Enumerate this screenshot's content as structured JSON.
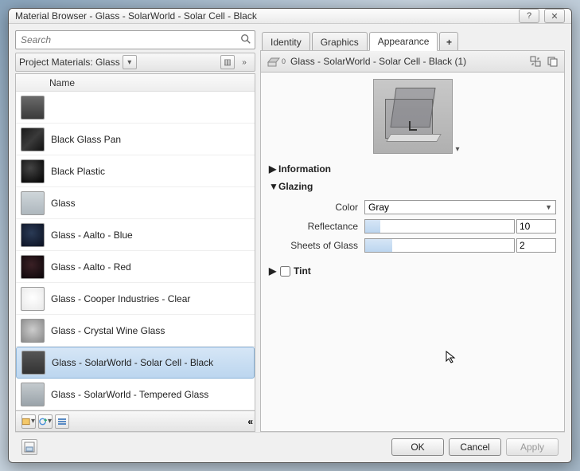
{
  "titlebar": {
    "title": "Material Browser - Glass - SolarWorld - Solar Cell - Black"
  },
  "search": {
    "placeholder": "Search"
  },
  "filter": {
    "label": "Project Materials: Glass"
  },
  "list": {
    "header": "Name",
    "items": [
      {
        "name": "",
        "sw": "sw-top"
      },
      {
        "name": "Black Glass Pan",
        "sw": "sw-blackglass"
      },
      {
        "name": "Black Plastic",
        "sw": "sw-blackplastic"
      },
      {
        "name": "Glass",
        "sw": "sw-glass"
      },
      {
        "name": "Glass - Aalto - Blue",
        "sw": "sw-aaltoblue"
      },
      {
        "name": "Glass - Aalto - Red",
        "sw": "sw-aaltored"
      },
      {
        "name": "Glass - Cooper Industries - Clear",
        "sw": "sw-cooper"
      },
      {
        "name": "Glass - Crystal Wine Glass",
        "sw": "sw-crystal"
      },
      {
        "name": "Glass - SolarWorld - Solar Cell - Black",
        "sw": "sw-solar",
        "selected": true
      },
      {
        "name": "Glass - SolarWorld - Tempered Glass",
        "sw": "sw-tempered"
      }
    ]
  },
  "tabs": {
    "identity": "Identity",
    "graphics": "Graphics",
    "appearance": "Appearance",
    "add": "+"
  },
  "asset": {
    "name": "Glass - SolarWorld - Solar Cell - Black (1)",
    "badge": "0"
  },
  "sections": {
    "information": "Information",
    "glazing": "Glazing",
    "tint": "Tint"
  },
  "props": {
    "color_label": "Color",
    "color_value": "Gray",
    "reflectance_label": "Reflectance",
    "reflectance_value": "10",
    "sheets_label": "Sheets of Glass",
    "sheets_value": "2"
  },
  "buttons": {
    "ok": "OK",
    "cancel": "Cancel",
    "apply": "Apply"
  },
  "collapse": "«",
  "expand": "»"
}
